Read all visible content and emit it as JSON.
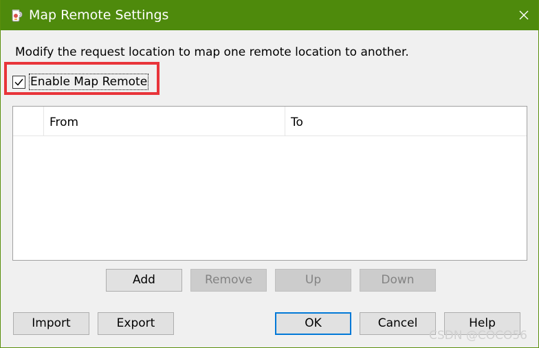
{
  "window": {
    "title": "Map Remote Settings",
    "title_bar_color": "#4e8a0c",
    "icon": "charles-jug-icon"
  },
  "description": "Modify the request location to map one remote location to another.",
  "enable_checkbox": {
    "label": "Enable Map Remote",
    "checked": true,
    "highlight_color": "#e8343a"
  },
  "table": {
    "columns": [
      "",
      "From",
      "To"
    ],
    "rows": []
  },
  "list_buttons": {
    "add": "Add",
    "remove": "Remove",
    "up": "Up",
    "down": "Down"
  },
  "dialog_buttons": {
    "import": "Import",
    "export": "Export",
    "ok": "OK",
    "cancel": "Cancel",
    "help": "Help"
  },
  "watermark": "CSDN @COCO56"
}
